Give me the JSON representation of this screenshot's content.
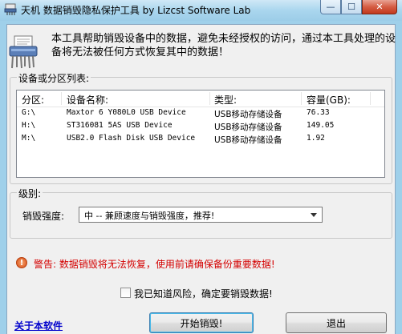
{
  "window": {
    "title": "天机 数据销毁隐私保护工具  by Lizcst Software Lab",
    "minimize_glyph": "—",
    "restore_glyph": "☐",
    "close_glyph": "✕"
  },
  "intro_text": "本工具帮助销毁设备中的数据，避免未经授权的访问，通过本工具处理的设备将无法被任何方式恢复其中的数据！",
  "device_group": {
    "title": "设备或分区列表:",
    "columns": [
      "分区:",
      "设备名称:",
      "类型:",
      "容量(GB):"
    ],
    "rows": [
      {
        "partition": "G:\\",
        "name": "Maxtor 6 Y080L0 USB Device",
        "type": "USB移动存储设备",
        "capacity": "76.33"
      },
      {
        "partition": "H:\\",
        "name": "ST316081 5AS USB Device",
        "type": "USB移动存储设备",
        "capacity": "149.05"
      },
      {
        "partition": "M:\\",
        "name": "USB2.0 Flash Disk USB Device",
        "type": "USB移动存储设备",
        "capacity": "1.92"
      }
    ]
  },
  "level_group": {
    "title": "级别:",
    "strength_label": "销毁强度:",
    "strength_value": "中 -- 兼顾速度与销毁强度，推荐!"
  },
  "warning": {
    "icon_glyph": "!",
    "text": "警告: 数据销毁将无法恢复，使用前请确保备份重要数据!"
  },
  "confirm": {
    "checked": false,
    "label": "我已知道风险，确定要销毁数据!"
  },
  "footer": {
    "about_link": "关于本软件",
    "start_button": "开始销毁!",
    "exit_button": "退出"
  },
  "colors": {
    "warning_red": "#d40000",
    "link_blue": "#0000cc",
    "titlebar": "#9fd0ea"
  }
}
